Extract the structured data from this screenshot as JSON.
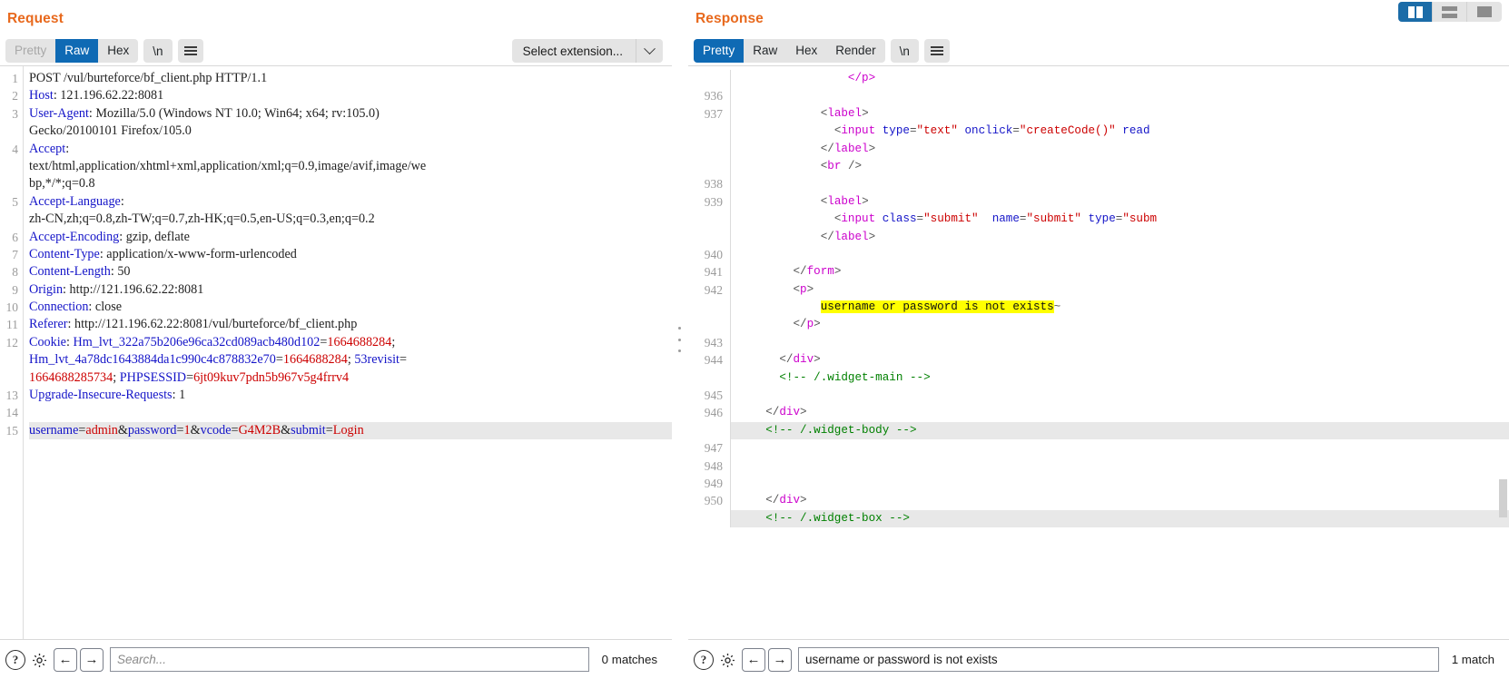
{
  "layout_toggle": {
    "buttons": [
      {
        "name": "side-by-side",
        "label": "Side by side view",
        "active": true
      },
      {
        "name": "stacked",
        "label": "Stacked view",
        "active": false
      },
      {
        "name": "single",
        "label": "Single pane view",
        "active": false
      }
    ]
  },
  "request": {
    "title": "Request",
    "tabs": [
      {
        "label": "Pretty",
        "state": "disabled"
      },
      {
        "label": "Raw",
        "state": "active"
      },
      {
        "label": "Hex",
        "state": "normal"
      }
    ],
    "newline_pill": "\\n",
    "menu_icon": "hamburger-icon",
    "extension_select": {
      "label": "Select extension...",
      "arrow_icon": "chevron-down-icon"
    },
    "lines": [
      {
        "n": "1",
        "segs": [
          {
            "t": "POST /vul/burteforce/bf_client.php HTTP/1.1",
            "c": "val"
          }
        ]
      },
      {
        "n": "2",
        "segs": [
          {
            "t": "Host",
            "c": "hdr"
          },
          {
            "t": ": 121.196.62.22:8081",
            "c": "val"
          }
        ]
      },
      {
        "n": "3",
        "segs": [
          {
            "t": "User-Agent",
            "c": "hdr"
          },
          {
            "t": ": Mozilla/5.0 (Windows NT 10.0; Win64; x64; rv:105.0)",
            "c": "val"
          }
        ]
      },
      {
        "n": "",
        "segs": [
          {
            "t": "Gecko/20100101 Firefox/105.0",
            "c": "val"
          }
        ]
      },
      {
        "n": "4",
        "segs": [
          {
            "t": "Accept",
            "c": "hdr"
          },
          {
            "t": ":",
            "c": "val"
          }
        ]
      },
      {
        "n": "",
        "segs": [
          {
            "t": "text/html,application/xhtml+xml,application/xml;q=0.9,image/avif,image/we",
            "c": "val"
          }
        ]
      },
      {
        "n": "",
        "segs": [
          {
            "t": "bp,*/*;q=0.8",
            "c": "val"
          }
        ]
      },
      {
        "n": "5",
        "segs": [
          {
            "t": "Accept-Language",
            "c": "hdr"
          },
          {
            "t": ":",
            "c": "val"
          }
        ]
      },
      {
        "n": "",
        "segs": [
          {
            "t": "zh-CN,zh;q=0.8,zh-TW;q=0.7,zh-HK;q=0.5,en-US;q=0.3,en;q=0.2",
            "c": "val"
          }
        ]
      },
      {
        "n": "6",
        "segs": [
          {
            "t": "Accept-Encoding",
            "c": "hdr"
          },
          {
            "t": ": gzip, deflate",
            "c": "val"
          }
        ]
      },
      {
        "n": "7",
        "segs": [
          {
            "t": "Content-Type",
            "c": "hdr"
          },
          {
            "t": ": application/x-www-form-urlencoded",
            "c": "val"
          }
        ]
      },
      {
        "n": "8",
        "segs": [
          {
            "t": "Content-Length",
            "c": "hdr"
          },
          {
            "t": ": 50",
            "c": "val"
          }
        ]
      },
      {
        "n": "9",
        "segs": [
          {
            "t": "Origin",
            "c": "hdr"
          },
          {
            "t": ": http://121.196.62.22:8081",
            "c": "val"
          }
        ]
      },
      {
        "n": "10",
        "segs": [
          {
            "t": "Connection",
            "c": "hdr"
          },
          {
            "t": ": close",
            "c": "val"
          }
        ]
      },
      {
        "n": "11",
        "segs": [
          {
            "t": "Referer",
            "c": "hdr"
          },
          {
            "t": ": http://121.196.62.22:8081/vul/burteforce/bf_client.php",
            "c": "val"
          }
        ]
      },
      {
        "n": "12",
        "segs": [
          {
            "t": "Cookie",
            "c": "hdr"
          },
          {
            "t": ": ",
            "c": "val"
          },
          {
            "t": "Hm_lvt_322a75b206e96ca32cd089acb480d102",
            "c": "blue"
          },
          {
            "t": "=",
            "c": "val"
          },
          {
            "t": "1664688284",
            "c": "red"
          },
          {
            "t": ";",
            "c": "val"
          }
        ]
      },
      {
        "n": "",
        "segs": [
          {
            "t": "Hm_lvt_4a78dc1643884da1c990c4c878832e70",
            "c": "blue"
          },
          {
            "t": "=",
            "c": "val"
          },
          {
            "t": "1664688284",
            "c": "red"
          },
          {
            "t": "; ",
            "c": "val"
          },
          {
            "t": "53revisit",
            "c": "blue"
          },
          {
            "t": "=",
            "c": "val"
          }
        ]
      },
      {
        "n": "",
        "segs": [
          {
            "t": "1664688285734",
            "c": "red"
          },
          {
            "t": "; ",
            "c": "val"
          },
          {
            "t": "PHPSESSID",
            "c": "blue"
          },
          {
            "t": "=",
            "c": "val"
          },
          {
            "t": "6jt09kuv7pdn5b967v5g4frrv4",
            "c": "red"
          }
        ]
      },
      {
        "n": "13",
        "segs": [
          {
            "t": "Upgrade-Insecure-Requests",
            "c": "hdr"
          },
          {
            "t": ": 1",
            "c": "val"
          }
        ]
      },
      {
        "n": "14",
        "segs": [
          {
            "t": "",
            "c": "val"
          }
        ]
      },
      {
        "n": "15",
        "selected": true,
        "segs": [
          {
            "t": "username",
            "c": "blue"
          },
          {
            "t": "=",
            "c": "val"
          },
          {
            "t": "admin",
            "c": "red"
          },
          {
            "t": "&",
            "c": "val"
          },
          {
            "t": "password",
            "c": "blue"
          },
          {
            "t": "=",
            "c": "val"
          },
          {
            "t": "1",
            "c": "red"
          },
          {
            "t": "&",
            "c": "val"
          },
          {
            "t": "vcode",
            "c": "blue"
          },
          {
            "t": "=",
            "c": "val"
          },
          {
            "t": "G4M2B",
            "c": "red"
          },
          {
            "t": "&",
            "c": "val"
          },
          {
            "t": "submit",
            "c": "blue"
          },
          {
            "t": "=",
            "c": "val"
          },
          {
            "t": "Login",
            "c": "red"
          }
        ]
      }
    ],
    "footer": {
      "help_icon": "question-mark-icon",
      "settings_icon": "gear-icon",
      "prev_icon": "arrow-left-icon",
      "next_icon": "arrow-right-icon",
      "search_value": "",
      "search_placeholder": "Search...",
      "matches": "0 matches"
    }
  },
  "response": {
    "title": "Response",
    "tabs": [
      {
        "label": "Pretty",
        "state": "active"
      },
      {
        "label": "Raw",
        "state": "normal"
      },
      {
        "label": "Hex",
        "state": "normal"
      },
      {
        "label": "Render",
        "state": "normal"
      }
    ],
    "newline_pill": "\\n",
    "menu_icon": "hamburger-icon",
    "rows": [
      {
        "n": "",
        "clipped": true,
        "segs": [
          {
            "t": "                ",
            "c": "punc"
          },
          {
            "t": "</p>",
            "c": "tagp"
          }
        ]
      },
      {
        "n": "936",
        "segs": []
      },
      {
        "n": "937",
        "segs": [
          {
            "t": "            ",
            "c": "punc"
          },
          {
            "t": "<",
            "c": "punc"
          },
          {
            "t": "label",
            "c": "tagp"
          },
          {
            "t": ">",
            "c": "punc"
          }
        ]
      },
      {
        "n": "",
        "segs": [
          {
            "t": "              ",
            "c": "punc"
          },
          {
            "t": "<",
            "c": "punc"
          },
          {
            "t": "input",
            "c": "tagp"
          },
          {
            "t": " ",
            "c": "punc"
          },
          {
            "t": "type",
            "c": "attr"
          },
          {
            "t": "=",
            "c": "punc"
          },
          {
            "t": "\"text\"",
            "c": "aval"
          },
          {
            "t": " ",
            "c": "punc"
          },
          {
            "t": "onclick",
            "c": "attr"
          },
          {
            "t": "=",
            "c": "punc"
          },
          {
            "t": "\"createCode()\"",
            "c": "aval"
          },
          {
            "t": " ",
            "c": "punc"
          },
          {
            "t": "read",
            "c": "attr"
          }
        ]
      },
      {
        "n": "",
        "segs": [
          {
            "t": "            ",
            "c": "punc"
          },
          {
            "t": "</",
            "c": "punc"
          },
          {
            "t": "label",
            "c": "tagp"
          },
          {
            "t": ">",
            "c": "punc"
          }
        ]
      },
      {
        "n": "",
        "segs": [
          {
            "t": "            ",
            "c": "punc"
          },
          {
            "t": "<",
            "c": "punc"
          },
          {
            "t": "br",
            "c": "tagp"
          },
          {
            "t": " />",
            "c": "punc"
          }
        ]
      },
      {
        "n": "938",
        "segs": []
      },
      {
        "n": "939",
        "segs": [
          {
            "t": "            ",
            "c": "punc"
          },
          {
            "t": "<",
            "c": "punc"
          },
          {
            "t": "label",
            "c": "tagp"
          },
          {
            "t": ">",
            "c": "punc"
          }
        ]
      },
      {
        "n": "",
        "segs": [
          {
            "t": "              ",
            "c": "punc"
          },
          {
            "t": "<",
            "c": "punc"
          },
          {
            "t": "input",
            "c": "tagp"
          },
          {
            "t": " ",
            "c": "punc"
          },
          {
            "t": "class",
            "c": "attr"
          },
          {
            "t": "=",
            "c": "punc"
          },
          {
            "t": "\"submit\"",
            "c": "aval"
          },
          {
            "t": "  ",
            "c": "punc"
          },
          {
            "t": "name",
            "c": "attr"
          },
          {
            "t": "=",
            "c": "punc"
          },
          {
            "t": "\"submit\"",
            "c": "aval"
          },
          {
            "t": " ",
            "c": "punc"
          },
          {
            "t": "type",
            "c": "attr"
          },
          {
            "t": "=",
            "c": "punc"
          },
          {
            "t": "\"subm",
            "c": "aval"
          }
        ]
      },
      {
        "n": "",
        "segs": [
          {
            "t": "            ",
            "c": "punc"
          },
          {
            "t": "</",
            "c": "punc"
          },
          {
            "t": "label",
            "c": "tagp"
          },
          {
            "t": ">",
            "c": "punc"
          }
        ]
      },
      {
        "n": "940",
        "segs": []
      },
      {
        "n": "941",
        "segs": [
          {
            "t": "        ",
            "c": "punc"
          },
          {
            "t": "</",
            "c": "punc"
          },
          {
            "t": "form",
            "c": "tagp"
          },
          {
            "t": ">",
            "c": "punc"
          }
        ]
      },
      {
        "n": "942",
        "segs": [
          {
            "t": "        ",
            "c": "punc"
          },
          {
            "t": "<",
            "c": "punc"
          },
          {
            "t": "p",
            "c": "tagp"
          },
          {
            "t": ">",
            "c": "punc"
          }
        ]
      },
      {
        "n": "",
        "segs": [
          {
            "t": "            ",
            "c": "punc"
          },
          {
            "t": "username or password is not exists",
            "c": "hl"
          },
          {
            "t": "~",
            "c": "punc"
          }
        ]
      },
      {
        "n": "",
        "segs": [
          {
            "t": "        ",
            "c": "punc"
          },
          {
            "t": "</",
            "c": "punc"
          },
          {
            "t": "p",
            "c": "tagp"
          },
          {
            "t": ">",
            "c": "punc"
          }
        ]
      },
      {
        "n": "943",
        "segs": []
      },
      {
        "n": "944",
        "segs": [
          {
            "t": "      ",
            "c": "punc"
          },
          {
            "t": "</",
            "c": "punc"
          },
          {
            "t": "div",
            "c": "tagp"
          },
          {
            "t": ">",
            "c": "punc"
          }
        ]
      },
      {
        "n": "",
        "segs": [
          {
            "t": "      ",
            "c": "punc"
          },
          {
            "t": "<!-- /.widget-main -->",
            "c": "cmt"
          }
        ]
      },
      {
        "n": "945",
        "segs": []
      },
      {
        "n": "946",
        "segs": [
          {
            "t": "    ",
            "c": "punc"
          },
          {
            "t": "</",
            "c": "punc"
          },
          {
            "t": "div",
            "c": "tagp"
          },
          {
            "t": ">",
            "c": "punc"
          }
        ]
      },
      {
        "n": "",
        "shaded": true,
        "segs": [
          {
            "t": "    ",
            "c": "punc"
          },
          {
            "t": "<!-- /.widget-body -->",
            "c": "cmt"
          }
        ]
      },
      {
        "n": "947",
        "segs": []
      },
      {
        "n": "948",
        "segs": []
      },
      {
        "n": "949",
        "segs": []
      },
      {
        "n": "950",
        "segs": [
          {
            "t": "    ",
            "c": "punc"
          },
          {
            "t": "</",
            "c": "punc"
          },
          {
            "t": "div",
            "c": "tagp"
          },
          {
            "t": ">",
            "c": "punc"
          }
        ]
      },
      {
        "n": "",
        "clipped": true,
        "shaded": true,
        "segs": [
          {
            "t": "    ",
            "c": "punc"
          },
          {
            "t": "<!-- /.widget-box -->",
            "c": "cmt"
          }
        ]
      }
    ],
    "footer": {
      "help_icon": "question-mark-icon",
      "settings_icon": "gear-icon",
      "prev_icon": "arrow-left-icon",
      "next_icon": "arrow-right-icon",
      "search_value": "username or password is not exists",
      "search_placeholder": "Search...",
      "matches": "1 match"
    }
  },
  "colors": {
    "accent_orange": "#e8691d",
    "tab_active_blue": "#0f6ab4",
    "highlight_yellow": "#ffff00",
    "header_blue": "#1414c8",
    "value_red": "#cc0000",
    "tag_magenta": "#cc00cc",
    "comment_green": "#008000",
    "selection_grey": "#e8e8e8"
  }
}
